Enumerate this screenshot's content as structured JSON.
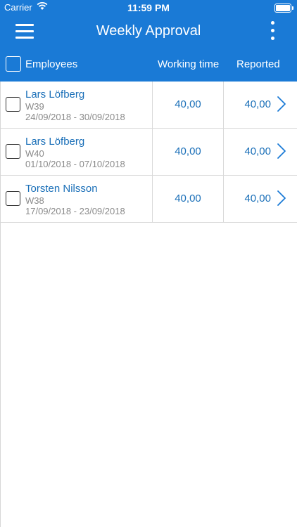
{
  "status": {
    "carrier": "Carrier",
    "time": "11:59 PM"
  },
  "nav": {
    "title": "Weekly Approval"
  },
  "table": {
    "headers": {
      "employees": "Employees",
      "working_time": "Working time",
      "reported": "Reported"
    },
    "rows": [
      {
        "name": "Lars Löfberg",
        "week": "W39",
        "period": "24/09/2018 - 30/09/2018",
        "working_time": "40,00",
        "reported": "40,00"
      },
      {
        "name": "Lars Löfberg",
        "week": "W40",
        "period": "01/10/2018 - 07/10/2018",
        "working_time": "40,00",
        "reported": "40,00"
      },
      {
        "name": "Torsten Nilsson",
        "week": "W38",
        "period": "17/09/2018 - 23/09/2018",
        "working_time": "40,00",
        "reported": "40,00"
      }
    ]
  },
  "colors": {
    "primary": "#1a7ad6",
    "link_text": "#1a6fb8",
    "secondary_text": "#8a8a8a"
  },
  "icons": {
    "menu": "hamburger-menu-icon",
    "more": "vertical-ellipsis-icon",
    "row_action": "chevron-right-icon"
  }
}
